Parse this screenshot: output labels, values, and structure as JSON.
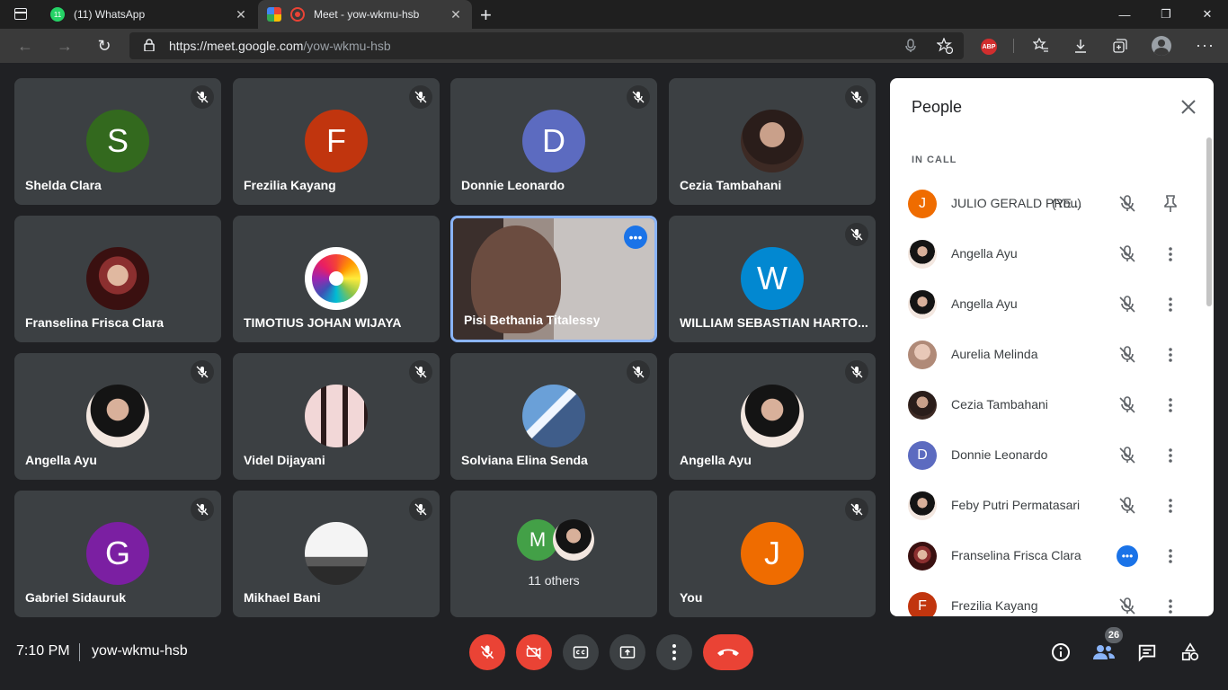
{
  "browser": {
    "tabs": [
      {
        "title": "(11) WhatsApp",
        "badge": "11"
      },
      {
        "title": "Meet - yow-wkmu-hsb"
      }
    ],
    "url_host": "https://meet.google.com",
    "url_path": "/yow-wkmu-hsb",
    "abp_label": "ABP"
  },
  "tiles": [
    {
      "name": "Shelda Clara",
      "initial": "S",
      "color": "#33691e"
    },
    {
      "name": "Frezilia Kayang",
      "initial": "F",
      "color": "#c1350e"
    },
    {
      "name": "Donnie Leonardo",
      "initial": "D",
      "color": "#5c6bc0"
    },
    {
      "name": "Cezia Tambahani"
    },
    {
      "name": "Franselina Frisca Clara"
    },
    {
      "name": "TIMOTIUS JOHAN WIJAYA"
    },
    {
      "name": "Pisi Bethania Titalessy"
    },
    {
      "name": "WILLIAM SEBASTIAN HARTO...",
      "initial": "W",
      "color": "#0288d1"
    },
    {
      "name": "Angella Ayu"
    },
    {
      "name": "Videl Dijayani"
    },
    {
      "name": "Solviana Elina Senda"
    },
    {
      "name": "Angella Ayu"
    },
    {
      "name": "Gabriel Sidauruk",
      "initial": "G",
      "color": "#7b1fa2"
    },
    {
      "name": "Mikhael Bani"
    },
    {
      "name": "11 others",
      "initial": "M",
      "color": "#43a047"
    },
    {
      "name": "You",
      "initial": "J",
      "color": "#ef6c00"
    }
  ],
  "panel": {
    "title": "People",
    "section": "IN CALL",
    "people": [
      {
        "name": "JULIO GERALD PRE...",
        "you": "(You)",
        "initial": "J",
        "color": "#ef6c00"
      },
      {
        "name": "Angella Ayu"
      },
      {
        "name": "Angella Ayu"
      },
      {
        "name": "Aurelia Melinda"
      },
      {
        "name": "Cezia Tambahani"
      },
      {
        "name": "Donnie Leonardo",
        "initial": "D",
        "color": "#5c6bc0"
      },
      {
        "name": "Feby Putri Permatasari"
      },
      {
        "name": "Franselina Frisca Clara"
      },
      {
        "name": "Frezilia Kayang",
        "initial": "F",
        "color": "#c1350e"
      }
    ]
  },
  "bottom": {
    "time": "7:10 PM",
    "meeting_code": "yow-wkmu-hsb",
    "participant_count": "26"
  }
}
